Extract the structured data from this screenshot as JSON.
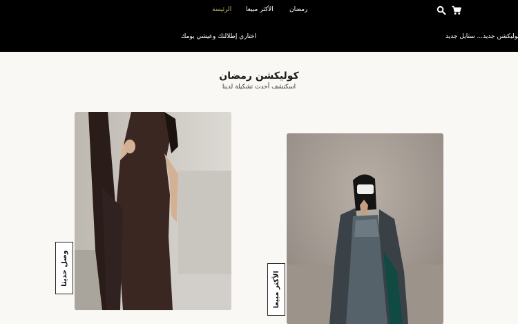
{
  "nav": {
    "home": "الرئيسة",
    "best_sellers": "الأكثر مبيعا",
    "ramadan": "رمضان"
  },
  "icons": {
    "search": "search-icon",
    "cart": "cart-icon"
  },
  "promo": {
    "left_text": "اختاري إطلالتك وعيشي يومك",
    "right_text": "كوليكشن جديد... ستايل جديد"
  },
  "hero": {
    "title": "كوليكشن رمضان",
    "subtitle": "اسكتشف أحدث تشكيلة لدينا"
  },
  "cards": [
    {
      "label": "وصل حديثا"
    },
    {
      "label": "الأكثر مبيعا"
    }
  ],
  "colors": {
    "header_bg": "#000000",
    "active_nav": "#c9b56a",
    "page_bg": "#f9f8f4"
  }
}
